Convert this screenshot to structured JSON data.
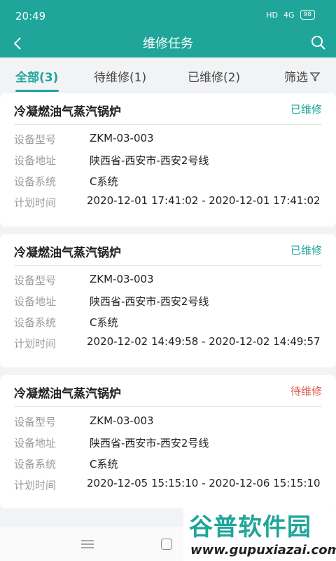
{
  "status_bar": {
    "time": "20:49",
    "network": "HD",
    "signal": "4G",
    "battery": "98"
  },
  "header": {
    "title": "维修任务"
  },
  "tabs": [
    {
      "label": "全部(3)",
      "active": true
    },
    {
      "label": "待维修(1)",
      "active": false
    },
    {
      "label": "已维修(2)",
      "active": false
    }
  ],
  "filter": {
    "label": "筛选"
  },
  "field_labels": {
    "model": "设备型号",
    "address": "设备地址",
    "system": "设备系统",
    "time": "计划时间"
  },
  "tasks": [
    {
      "title": "冷凝燃油气蒸汽锅炉",
      "status": "已维修",
      "model": "ZKM-03-003",
      "address": "陕西省-西安市-西安2号线",
      "system": "C系统",
      "time": "2020-12-01 17:41:02 - 2020-12-01 17:41:02"
    },
    {
      "title": "冷凝燃油气蒸汽锅炉",
      "status": "已维修",
      "model": "ZKM-03-003",
      "address": "陕西省-西安市-西安2号线",
      "system": "C系统",
      "time": "2020-12-02 14:49:58 - 2020-12-02 14:49:57"
    },
    {
      "title": "冷凝燃油气蒸汽锅炉",
      "status": "待维修",
      "model": "ZKM-03-003",
      "address": "陕西省-西安市-西安2号线",
      "system": "C系统",
      "time": "2020-12-05 15:15:10 - 2020-12-06 15:15:10"
    }
  ],
  "watermark": {
    "logo": "谷普软件园",
    "url": "www.gupuxiazai.com"
  },
  "colors": {
    "accent": "#1fa59a",
    "pending": "#e05a4f"
  }
}
